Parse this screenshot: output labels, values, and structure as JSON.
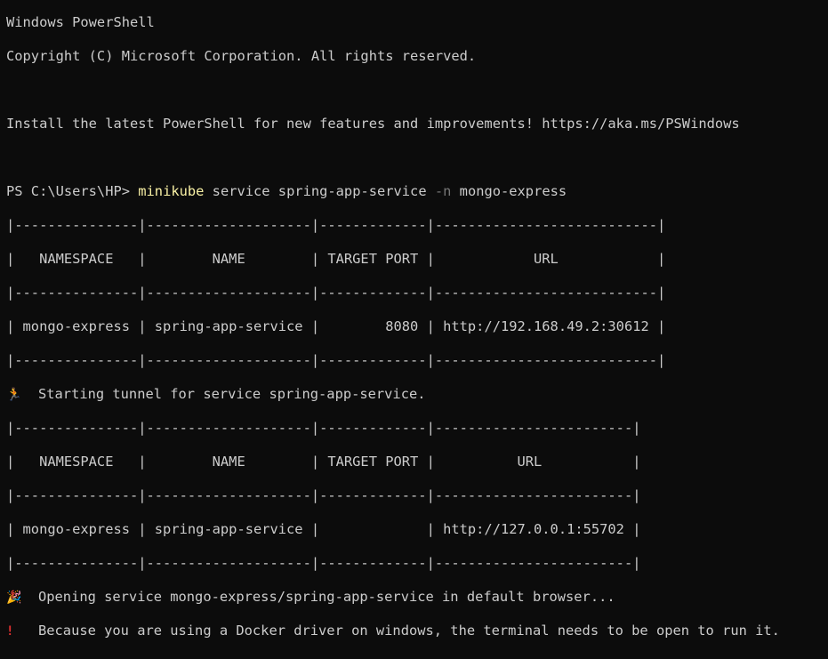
{
  "window": {
    "header_line1": "Windows PowerShell",
    "header_line2": "Copyright (C) Microsoft Corporation. All rights reserved.",
    "install_msg": "Install the latest PowerShell for new features and improvements! https://aka.ms/PSWindows"
  },
  "command": {
    "prompt": "PS C:\\Users\\HP> ",
    "exe": "minikube",
    "args1": " service spring-app-service ",
    "flag": "-n",
    "args2": " mongo-express"
  },
  "table1": {
    "border_top": "|---------------|--------------------|-------------|---------------------------|",
    "header": "|   NAMESPACE   |        NAME        | TARGET PORT |            URL            |",
    "border_mid": "|---------------|--------------------|-------------|---------------------------|",
    "row": "| mongo-express | spring-app-service |        8080 | http://192.168.49.2:30612 |",
    "border_bot": "|---------------|--------------------|-------------|---------------------------|"
  },
  "tunnel_msg": "Starting tunnel for service spring-app-service.",
  "table2": {
    "border_top": "|---------------|--------------------|-------------|------------------------|",
    "header": "|   NAMESPACE   |        NAME        | TARGET PORT |          URL           |",
    "border_mid": "|---------------|--------------------|-------------|------------------------|",
    "row": "| mongo-express | spring-app-service |             | http://127.0.0.1:55702 |",
    "border_bot": "|---------------|--------------------|-------------|------------------------|"
  },
  "open_msg": "Opening service mongo-express/spring-app-service in default browser...",
  "warn_msg": "Because you are using a Docker driver on windows, the terminal needs to be open to run it.",
  "icons": {
    "runner": "runner-emoji-icon",
    "party": "party-popper-emoji-icon",
    "warning": "exclamation-emoji-icon"
  }
}
